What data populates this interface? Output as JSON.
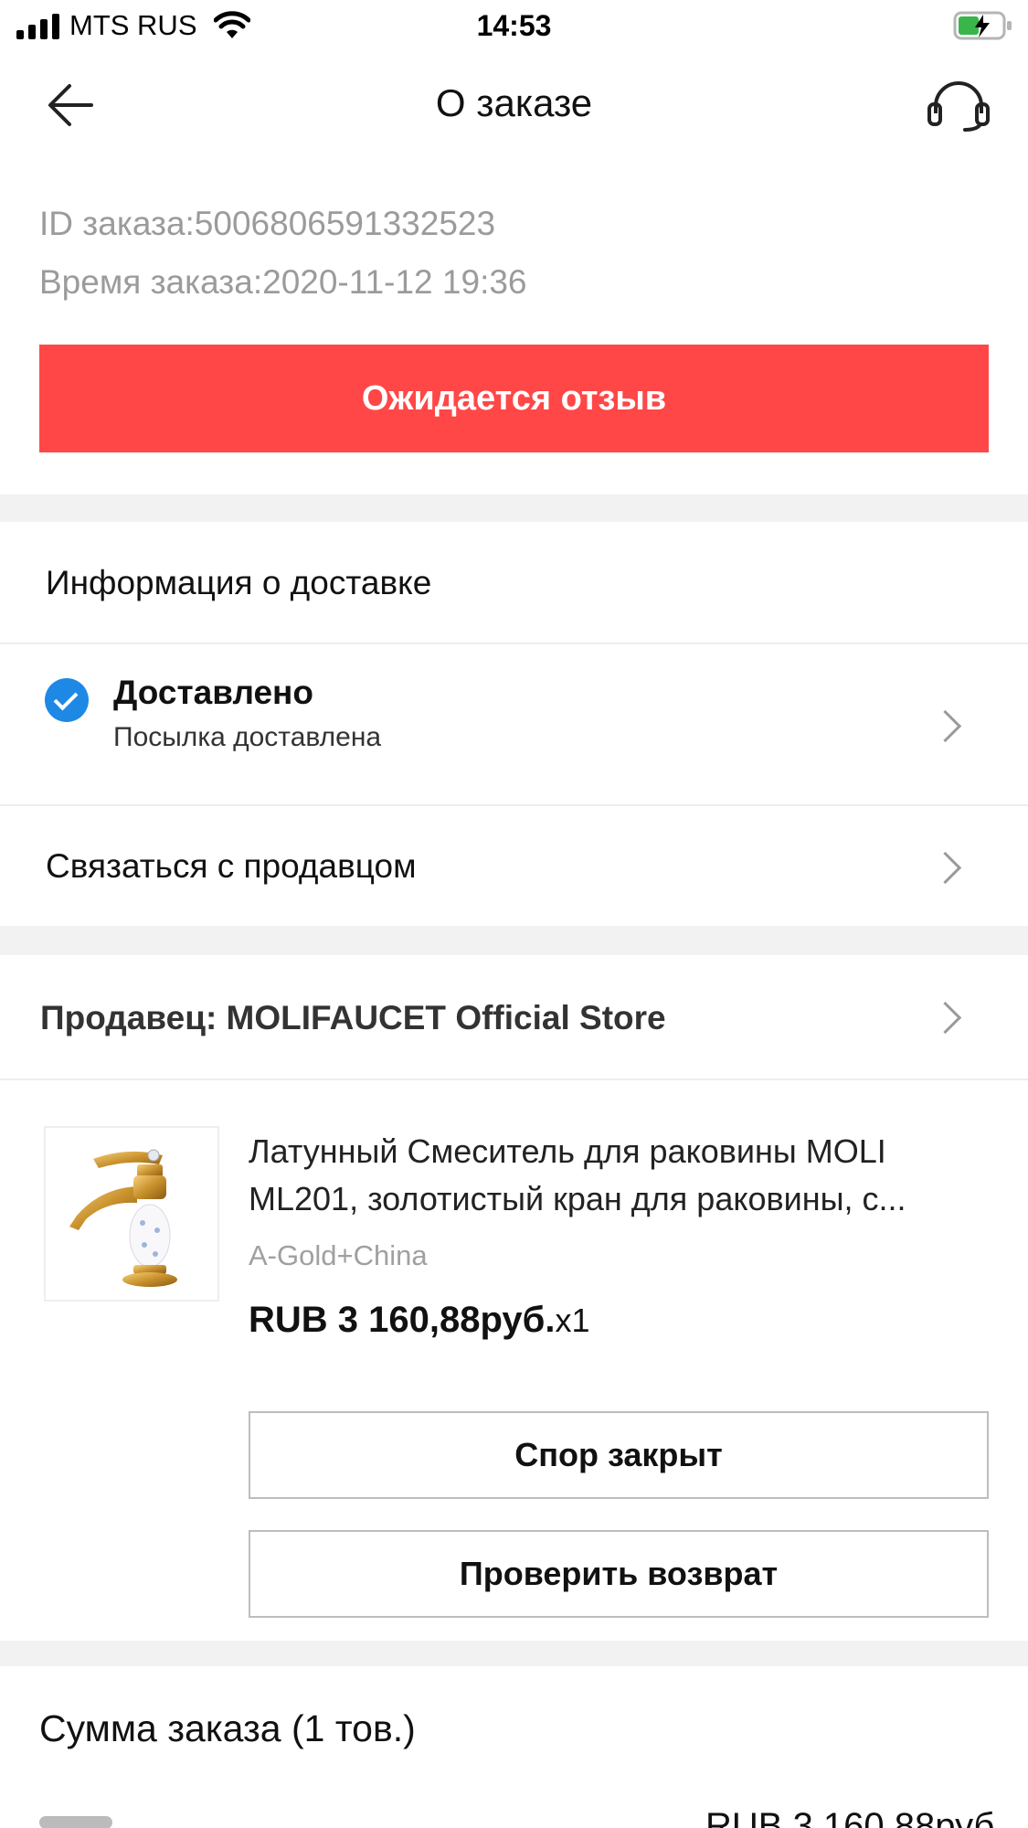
{
  "status_bar": {
    "carrier": "MTS RUS",
    "time": "14:53",
    "battery_color": "#39b54a"
  },
  "header": {
    "title": "О заказе",
    "back_icon": "arrow-left-icon",
    "support_icon": "headset-icon"
  },
  "order": {
    "id_line": "ID заказа:5006806591332523",
    "time_line": "Время заказа:2020-11-12 19:36",
    "status_label": "Ожидается отзыв",
    "accent_color": "#ff4747"
  },
  "delivery": {
    "section_title": "Информация о доставке",
    "status_title": "Доставлено",
    "status_subtitle": "Посылка доставлена",
    "status_icon": "check-circle-icon",
    "contact_label": "Связаться с продавцом"
  },
  "seller": {
    "label": "Продавец: MOLIFAUCET Official Store"
  },
  "product": {
    "title": "Латунный Смеситель для раковины MOLI ML201, золотистый кран для раковины, с...",
    "variant": "A-Gold+China",
    "price": "RUB 3 160,88руб.",
    "quantity": "x1",
    "dispute_button": "Спор закрыт",
    "return_button": "Проверить возврат"
  },
  "summary": {
    "title": "Сумма заказа (1 тов.)",
    "subtotal_partial": "RUB 3 160,88руб."
  }
}
